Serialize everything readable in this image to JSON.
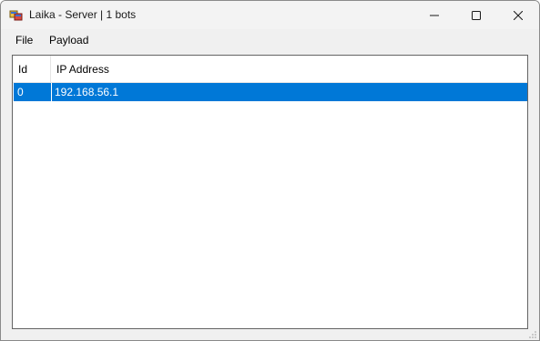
{
  "window": {
    "title": "Laika - Server | 1 bots",
    "icon": "app-window-icon",
    "controls": [
      "minimize-icon",
      "maximize-icon",
      "close-icon"
    ]
  },
  "menu": {
    "file": "File",
    "payload": "Payload"
  },
  "list": {
    "columns": [
      "Id",
      "IP Address"
    ],
    "rows": [
      {
        "id": "0",
        "ip": "192.168.56.1",
        "selected": true
      }
    ]
  },
  "colors": {
    "selection": "#0078d7",
    "selection_text": "#ffffff",
    "window_bg": "#f0f0f0"
  }
}
